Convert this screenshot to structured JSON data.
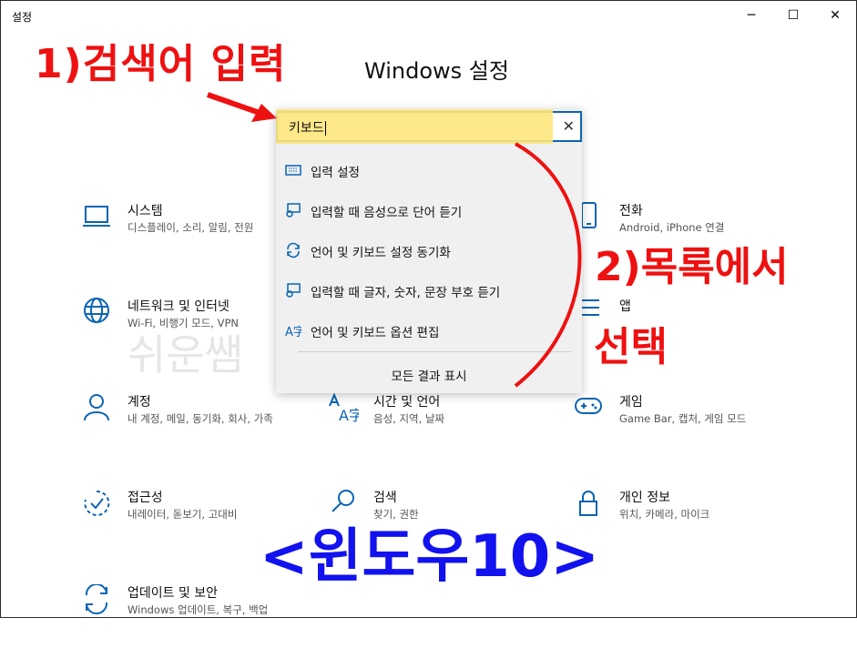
{
  "window": {
    "title": "설정",
    "minimize_glyph": "─",
    "maximize_glyph": "☐",
    "close_glyph": "✕"
  },
  "page_title": "Windows 설정",
  "search": {
    "value": "키보드",
    "clear_glyph": "✕",
    "suggestions": [
      {
        "label": "입력 설정",
        "icon": "keyboard-icon"
      },
      {
        "label": "입력할 때 음성으로 단어 듣기",
        "icon": "speech-icon"
      },
      {
        "label": "언어 및 키보드 설정 동기화",
        "icon": "sync-icon"
      },
      {
        "label": "입력할 때 글자, 숫자, 문장 부호 듣기",
        "icon": "speech-icon"
      },
      {
        "label": "언어 및 키보드 옵션 편집",
        "icon": "language-icon"
      }
    ],
    "show_all": "모든 결과 표시"
  },
  "tiles": {
    "system": {
      "name": "시스템",
      "desc": "디스플레이, 소리, 알림, 전원"
    },
    "phone": {
      "name": "전화",
      "desc": "Android, iPhone 연결"
    },
    "network": {
      "name": "네트워크 및 인터넷",
      "desc": "Wi-Fi, 비행기 모드, VPN"
    },
    "apps": {
      "name": "앱",
      "desc": ""
    },
    "accounts": {
      "name": "계정",
      "desc": "내 계정, 메일, 동기화, 회사, 가족"
    },
    "time": {
      "name": "시간 및 언어",
      "desc": "음성, 지역, 날짜"
    },
    "gaming": {
      "name": "게임",
      "desc": "Game Bar, 캡처, 게임 모드"
    },
    "ease": {
      "name": "접근성",
      "desc": "내레이터, 돋보기, 고대비"
    },
    "search": {
      "name": "검색",
      "desc": "찾기, 권한"
    },
    "privacy": {
      "name": "개인 정보",
      "desc": "위치, 카메라, 마이크"
    },
    "update": {
      "name": "업데이트 및 보안",
      "desc": "Windows 업데이트, 복구, 백업"
    }
  },
  "annotations": {
    "step1": "1)검색어 입력",
    "step2_line1": "2)목록에서",
    "step2_line2": "선택",
    "footer": "<윈도우10>",
    "watermark": "쉬운쌤"
  },
  "colors": {
    "accent": "#0a64b4",
    "annotation_red": "#ee1111",
    "annotation_blue": "#1212ee",
    "highlight": "#fde57d"
  }
}
